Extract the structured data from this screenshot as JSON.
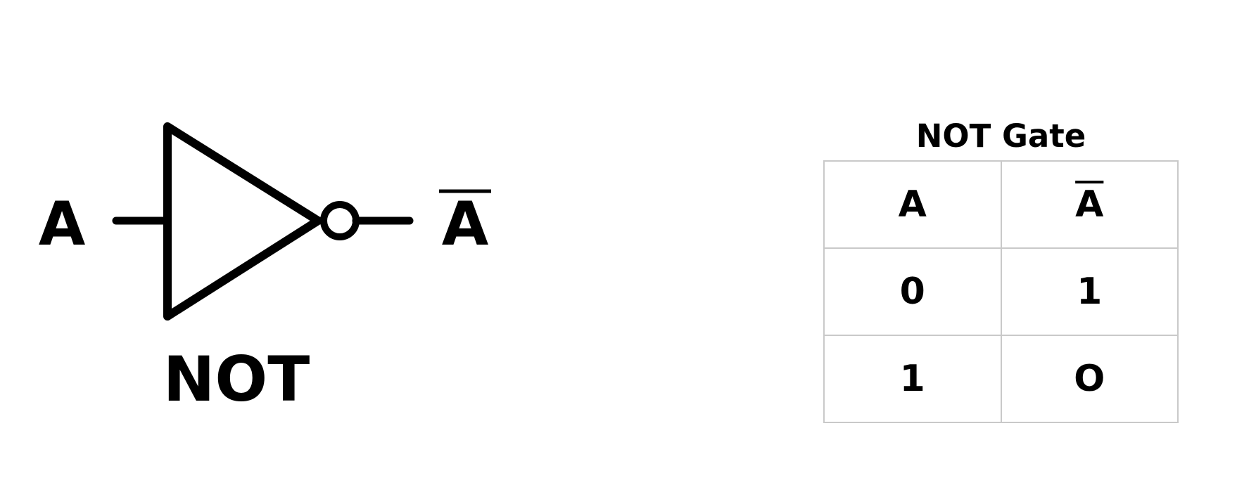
{
  "diagram": {
    "input_label": "A",
    "output_label": "A",
    "gate_label": "NOT"
  },
  "truth_table": {
    "title": "NOT Gate",
    "headers": [
      "A",
      "A"
    ],
    "rows": [
      [
        "0",
        "1"
      ],
      [
        "1",
        "O"
      ]
    ]
  }
}
